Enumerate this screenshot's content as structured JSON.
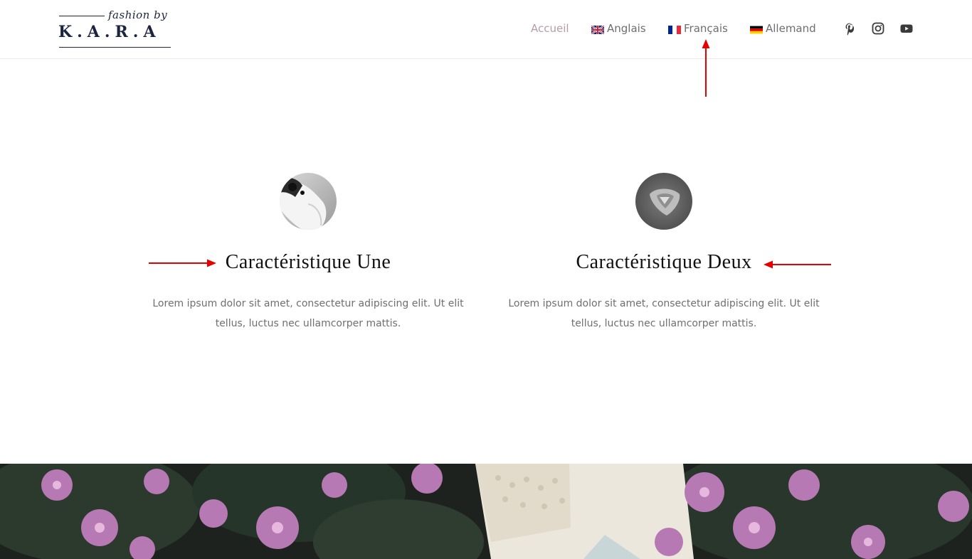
{
  "brand": {
    "script": "fashion by",
    "wordmark": "K.A.R.A"
  },
  "nav": {
    "items": [
      {
        "label": "Accueil",
        "active": true,
        "flag": null
      },
      {
        "label": "Anglais",
        "active": false,
        "flag": "uk-flag-icon"
      },
      {
        "label": "Français",
        "active": false,
        "flag": "fr-flag-icon"
      },
      {
        "label": "Allemand",
        "active": false,
        "flag": "de-flag-icon"
      }
    ],
    "social": [
      "pinterest-icon",
      "instagram-icon",
      "youtube-icon"
    ],
    "active_color": "#b99aa8"
  },
  "features": [
    {
      "title": "Caractéristique Une",
      "text": "Lorem ipsum dolor sit amet, consectetur adipiscing elit. Ut elit tellus, luctus nec ullamcorper mattis.",
      "image": "game-controller-image"
    },
    {
      "title": "Caractéristique Deux",
      "text": "Lorem ipsum dolor sit amet, consectetur adipiscing elit. Ut elit tellus, luctus nec ullamcorper mattis.",
      "image": "guitar-pick-image"
    }
  ],
  "annotations": {
    "arrow_color": "#e60000"
  }
}
